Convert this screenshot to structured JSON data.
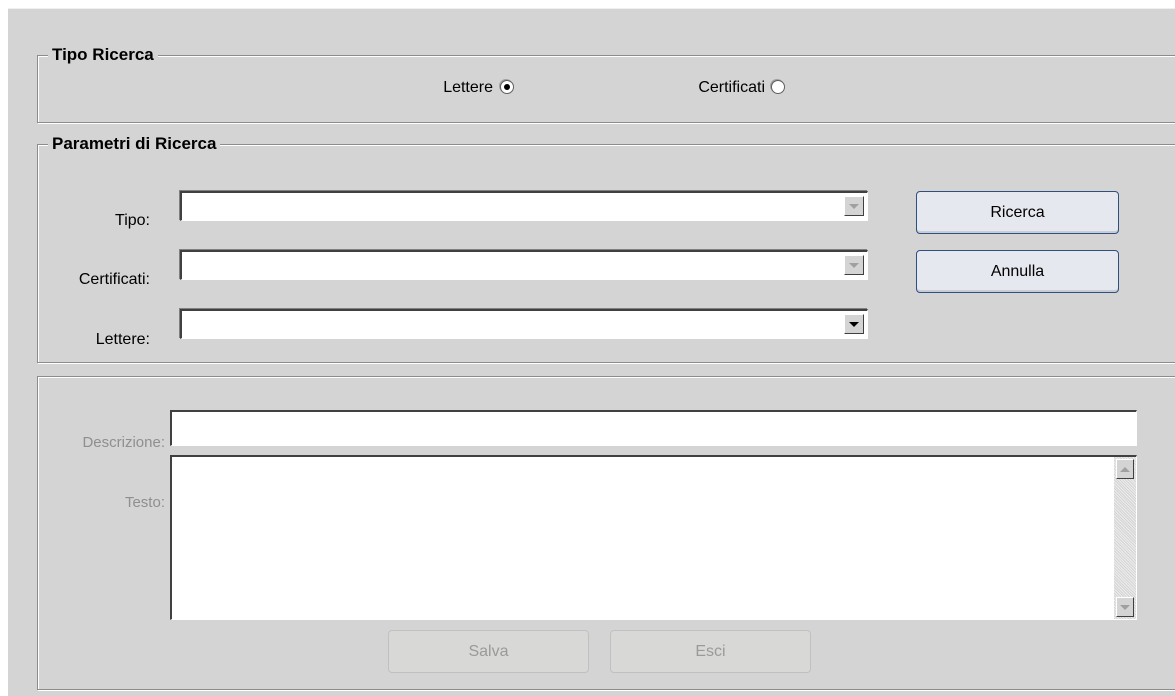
{
  "search_type": {
    "title": "Tipo Ricerca",
    "option_letters": "Lettere",
    "option_certificates": "Certificati",
    "selected": "Lettere"
  },
  "search_params": {
    "title": "Parametri di Ricerca",
    "tipo_label": "Tipo:",
    "tipo_value": "",
    "certificati_label": "Certificati:",
    "certificati_value": "",
    "lettere_label": "Lettere:",
    "lettere_value": "",
    "search_button": "Ricerca",
    "cancel_button": "Annulla"
  },
  "detail": {
    "descrizione_label": "Descrizione:",
    "descrizione_value": "",
    "testo_label": "Testo:",
    "testo_value": "",
    "save_button": "Salva",
    "exit_button": "Esci"
  }
}
